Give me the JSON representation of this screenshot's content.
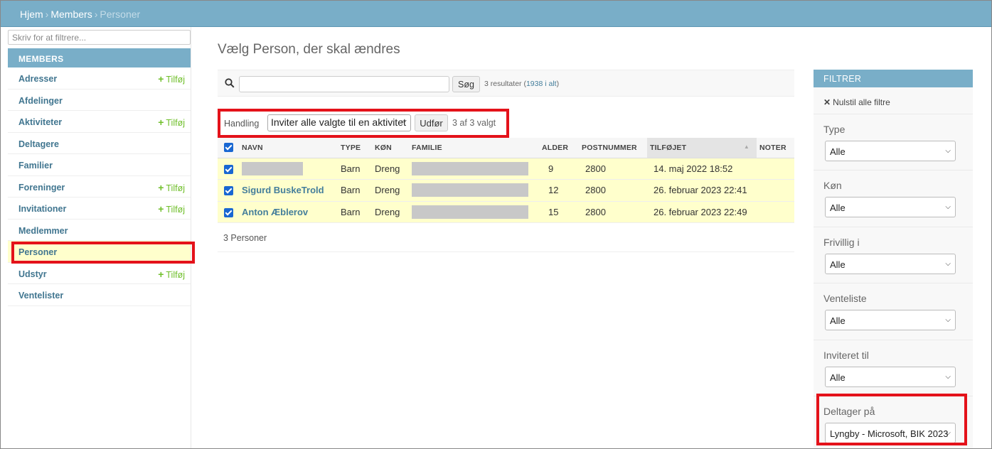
{
  "breadcrumb": {
    "home": "Hjem",
    "sep": "›",
    "app": "Members",
    "current": "Personer"
  },
  "sidebar": {
    "filter_placeholder": "Skriv for at filtrere...",
    "app_caption": "MEMBERS",
    "add_label": "Tilføj",
    "items": [
      {
        "label": "Adresser",
        "add": true
      },
      {
        "label": "Afdelinger",
        "add": false
      },
      {
        "label": "Aktiviteter",
        "add": true
      },
      {
        "label": "Deltagere",
        "add": false
      },
      {
        "label": "Familier",
        "add": false
      },
      {
        "label": "Foreninger",
        "add": true
      },
      {
        "label": "Invitationer",
        "add": true
      },
      {
        "label": "Medlemmer",
        "add": false
      },
      {
        "label": "Personer",
        "add": false,
        "current": true
      },
      {
        "label": "Udstyr",
        "add": true
      },
      {
        "label": "Ventelister",
        "add": false
      }
    ]
  },
  "main": {
    "title": "Vælg Person, der skal ændres",
    "search": {
      "button": "Søg",
      "result_text": "3 resultater (",
      "total_link": "1938 i alt",
      "result_close": ")"
    },
    "actions": {
      "label": "Handling",
      "selected_action": "Inviter alle valgte til en aktivitet",
      "go_button": "Udfør",
      "selected_count": "3 af 3 valgt"
    },
    "columns": [
      "NAVN",
      "TYPE",
      "KØN",
      "FAMILIE",
      "ALDER",
      "POSTNUMMER",
      "TILFØJET",
      "NOTER"
    ],
    "rows": [
      {
        "name": "",
        "name_redacted": true,
        "type": "Barn",
        "gender": "Dreng",
        "age": "9",
        "postal": "2800",
        "added": "14. maj 2022 18:52",
        "notes": ""
      },
      {
        "name": "Sigurd BuskeTrold",
        "name_redacted": false,
        "type": "Barn",
        "gender": "Dreng",
        "age": "12",
        "postal": "2800",
        "added": "26. februar 2023 22:41",
        "notes": ""
      },
      {
        "name": "Anton Æblerov",
        "name_redacted": false,
        "type": "Barn",
        "gender": "Dreng",
        "age": "15",
        "postal": "2800",
        "added": "26. februar 2023 22:49",
        "notes": ""
      }
    ],
    "paginator": "3 Personer"
  },
  "filters": {
    "title": "FILTRER",
    "clear_all": "Nulstil alle filtre",
    "groups": [
      {
        "label": "Type",
        "value": "Alle"
      },
      {
        "label": "Køn",
        "value": "Alle"
      },
      {
        "label": "Frivillig i",
        "value": "Alle"
      },
      {
        "label": "Venteliste",
        "value": "Alle"
      },
      {
        "label": "Inviteret til",
        "value": "Alle"
      },
      {
        "label": "Deltager på",
        "value": "Lyngby - Microsoft, BIK 2023"
      }
    ]
  },
  "colors": {
    "header": "#79aec8",
    "link": "#447e9b",
    "add": "#70bf2b",
    "row_selected": "#ffffcc",
    "highlight": "#e4121a"
  }
}
